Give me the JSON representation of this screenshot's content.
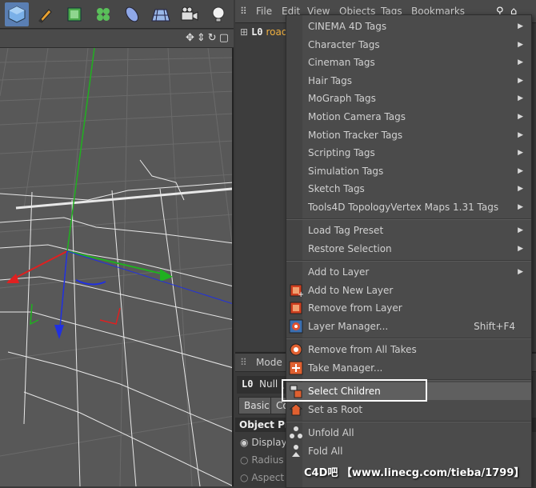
{
  "om_menubar": [
    "File",
    "Edit",
    "View",
    "Objects",
    "Tags",
    "Bookmarks"
  ],
  "object_manager": {
    "root_glyph": "L0",
    "object_name": "road"
  },
  "attributes": {
    "mode_label": "Mode",
    "object_glyph": "L0",
    "object_label": "Null [",
    "tab_basic": "Basic",
    "tab_co": "Co",
    "section_title": "Object Pro",
    "rows": [
      "Display",
      "Radius",
      "Aspect"
    ]
  },
  "context_menu": {
    "items": [
      {
        "label": "CINEMA 4D Tags",
        "submenu": true
      },
      {
        "label": "Character Tags",
        "submenu": true
      },
      {
        "label": "Cineman Tags",
        "submenu": true
      },
      {
        "label": "Hair Tags",
        "submenu": true
      },
      {
        "label": "MoGraph Tags",
        "submenu": true
      },
      {
        "label": "Motion Camera Tags",
        "submenu": true
      },
      {
        "label": "Motion Tracker Tags",
        "submenu": true
      },
      {
        "label": "Scripting Tags",
        "submenu": true
      },
      {
        "label": "Simulation Tags",
        "submenu": true
      },
      {
        "label": "Sketch Tags",
        "submenu": true
      },
      {
        "label": "Tools4D TopologyVertex Maps 1.31 Tags",
        "submenu": true
      },
      {
        "label": "Load Tag Preset",
        "submenu": true
      },
      {
        "label": "Restore Selection",
        "submenu": true
      },
      {
        "label": "Add to Layer",
        "submenu": true
      },
      {
        "label": "Add to New Layer",
        "submenu": false
      },
      {
        "label": "Remove from Layer",
        "submenu": false
      },
      {
        "label": "Layer Manager...",
        "submenu": false,
        "shortcut": "Shift+F4"
      },
      {
        "label": "Remove from All Takes",
        "submenu": false
      },
      {
        "label": "Take Manager...",
        "submenu": false
      },
      {
        "label": "Select Children",
        "submenu": false
      },
      {
        "label": "Set as Root",
        "submenu": false
      },
      {
        "label": "Unfold All",
        "submenu": false
      },
      {
        "label": "Fold All",
        "submenu": false
      }
    ]
  },
  "watermark": "C4D吧 【www.linecg.com/tieba/1799】",
  "colors": {
    "accent": "#5a7fb3",
    "highlight_border": "#ffffff",
    "axis_x": "#e02020",
    "axis_y": "#20b020",
    "axis_z": "#2030e0"
  }
}
